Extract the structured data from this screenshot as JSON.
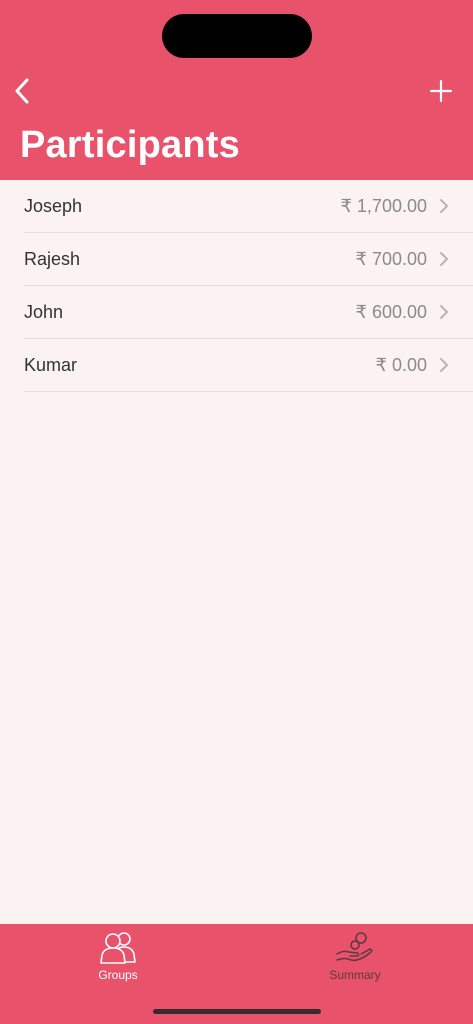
{
  "header": {
    "title": "Participants",
    "back_icon": "chevron-left-icon",
    "add_icon": "plus-icon",
    "background": "#e8526b"
  },
  "participants": [
    {
      "name": "Joseph",
      "amount": "₹ 1,700.00"
    },
    {
      "name": "Rajesh",
      "amount": "₹ 700.00"
    },
    {
      "name": "John",
      "amount": "₹ 600.00"
    },
    {
      "name": "Kumar",
      "amount": "₹ 0.00"
    }
  ],
  "tabbar": {
    "tabs": [
      {
        "label": "Groups",
        "icon": "groups-icon",
        "selected": true
      },
      {
        "label": "Summary",
        "icon": "money-hand-icon",
        "selected": false
      }
    ]
  }
}
